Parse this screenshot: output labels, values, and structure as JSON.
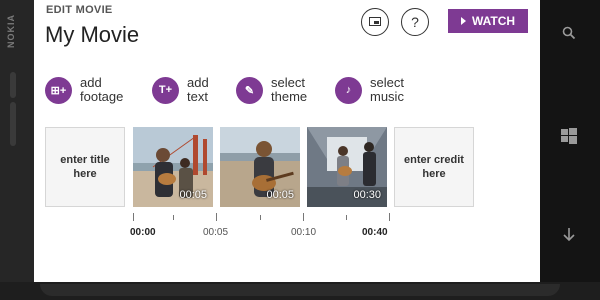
{
  "device": {
    "brand": "NOKIA"
  },
  "header": {
    "subtitle": "EDIT MOVIE",
    "title": "My Movie",
    "cast_icon": "cast-icon",
    "help_label": "?",
    "watch_label": "WATCH"
  },
  "actions": [
    {
      "line1": "add",
      "line2": "footage",
      "icon": "footage-icon",
      "glyph": "⊞+"
    },
    {
      "line1": "add",
      "line2": "text",
      "icon": "text-icon",
      "glyph": "T+"
    },
    {
      "line1": "select",
      "line2": "theme",
      "icon": "brush-icon",
      "glyph": "✎"
    },
    {
      "line1": "select",
      "line2": "music",
      "icon": "music-icon",
      "glyph": "♪"
    }
  ],
  "timeline": {
    "title_card": "enter title here",
    "credit_card": "enter credit here",
    "clips": [
      {
        "duration": "00:05"
      },
      {
        "duration": "00:05"
      },
      {
        "duration": "00:30"
      }
    ],
    "time_labels": [
      "00:00",
      "00:05",
      "00:10",
      "00:40"
    ]
  },
  "colors": {
    "accent": "#7e3a93"
  }
}
